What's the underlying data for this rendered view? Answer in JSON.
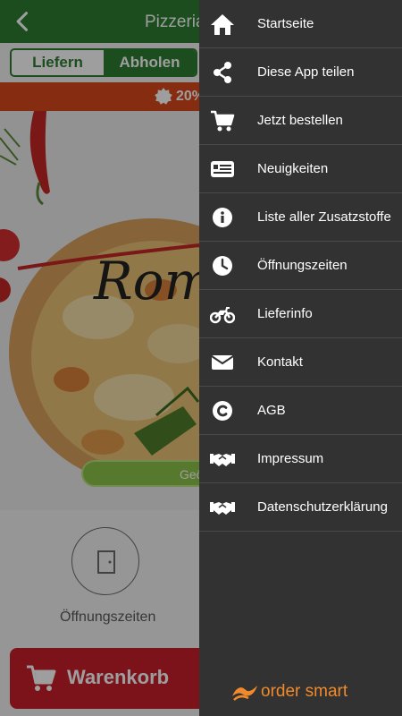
{
  "app": {
    "title": "Pizzeria",
    "mode_tabs": [
      {
        "label": "Liefern",
        "active": false
      },
      {
        "label": "Abholen",
        "active": true
      }
    ],
    "promo_text": "20%",
    "hero_script_text": "Rom",
    "open_button_label": "Geö",
    "hours_label": "Öffnungszeiten",
    "cart_label": "Warenkorb",
    "colors": {
      "primary": "#2e7d32",
      "promo": "#d84a1c",
      "cart": "#c8202a",
      "open_button": "#8bc34a",
      "drawer": "#323232",
      "brand": "#f08a2c"
    }
  },
  "drawer": {
    "items": [
      {
        "label": "Startseite",
        "icon": "home-icon"
      },
      {
        "label": "Diese App teilen",
        "icon": "share-icon"
      },
      {
        "label": "Jetzt bestellen",
        "icon": "cart-icon"
      },
      {
        "label": "Neuigkeiten",
        "icon": "news-icon"
      },
      {
        "label": "Liste aller Zusatzstoffe",
        "icon": "info-icon"
      },
      {
        "label": "Öffnungszeiten",
        "icon": "clock-icon"
      },
      {
        "label": "Lieferinfo",
        "icon": "motorcycle-icon"
      },
      {
        "label": "Kontakt",
        "icon": "mail-icon"
      },
      {
        "label": "AGB",
        "icon": "copyright-icon"
      },
      {
        "label": "Impressum",
        "icon": "handshake-icon"
      },
      {
        "label": "Datenschutzerklärung",
        "icon": "handshake-icon"
      }
    ],
    "brand_text": "order smart"
  }
}
